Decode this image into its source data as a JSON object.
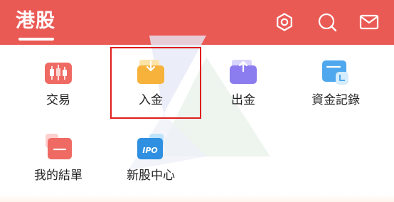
{
  "header": {
    "title": "港股"
  },
  "icons": {
    "settings": "gear-icon",
    "search": "search-icon",
    "message": "mail-icon"
  },
  "menu": {
    "items": [
      {
        "label": "交易",
        "icon": "trade-candlestick-icon"
      },
      {
        "label": "入金",
        "icon": "deposit-folder-icon"
      },
      {
        "label": "出金",
        "icon": "withdraw-folder-icon"
      },
      {
        "label": "資金記錄",
        "icon": "fund-record-icon"
      },
      {
        "label": "我的結單",
        "icon": "statement-icon"
      },
      {
        "label": "新股中心",
        "icon": "ipo-icon",
        "badge": "IPO"
      }
    ]
  },
  "colors": {
    "header_bg": "#ea5a55",
    "highlight_border": "#e01c1c"
  }
}
